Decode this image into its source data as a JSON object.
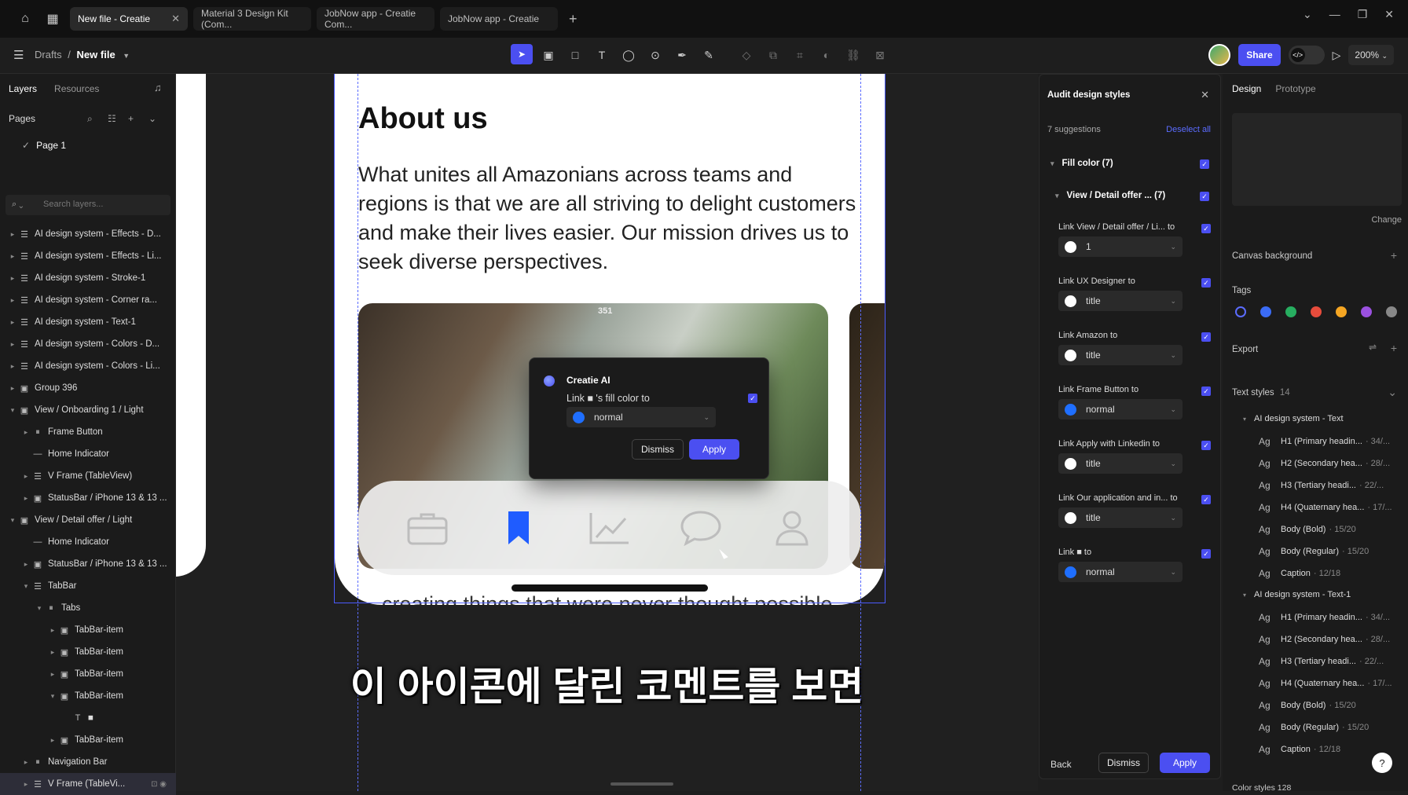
{
  "tabs": [
    {
      "label": "New file - Creatie",
      "active": true
    },
    {
      "label": "Material 3 Design Kit (Com...",
      "active": false
    },
    {
      "label": "JobNow app - Creatie Com...",
      "active": false
    },
    {
      "label": "JobNow app - Creatie",
      "active": false
    }
  ],
  "toolbar": {
    "crumb_parent": "Drafts",
    "crumb_sep": "/",
    "file_name": "New file",
    "share_label": "Share",
    "zoom": "200%"
  },
  "left": {
    "tab_layers": "Layers",
    "tab_resources": "Resources",
    "pages_label": "Pages",
    "page1": "Page 1",
    "search_placeholder": "Search layers...",
    "layers": [
      {
        "indent": 0,
        "arrow": "▸",
        "glyph": "☰",
        "label": "AI design system - Effects - D..."
      },
      {
        "indent": 0,
        "arrow": "▸",
        "glyph": "☰",
        "label": "AI design system - Effects - Li..."
      },
      {
        "indent": 0,
        "arrow": "▸",
        "glyph": "☰",
        "label": "AI design system - Stroke-1"
      },
      {
        "indent": 0,
        "arrow": "▸",
        "glyph": "☰",
        "label": "AI design system - Corner ra..."
      },
      {
        "indent": 0,
        "arrow": "▸",
        "glyph": "☰",
        "label": "AI design system - Text-1"
      },
      {
        "indent": 0,
        "arrow": "▸",
        "glyph": "☰",
        "label": "AI design system - Colors - D..."
      },
      {
        "indent": 0,
        "arrow": "▸",
        "glyph": "☰",
        "label": "AI design system - Colors - Li..."
      },
      {
        "indent": 0,
        "arrow": "▸",
        "glyph": "▣",
        "label": "Group 396"
      },
      {
        "indent": 0,
        "arrow": "▾",
        "glyph": "▣",
        "label": "View / Onboarding 1 / Light"
      },
      {
        "indent": 1,
        "arrow": "▸",
        "glyph": "⏸",
        "label": "Frame Button"
      },
      {
        "indent": 1,
        "arrow": "",
        "glyph": "—",
        "label": "Home Indicator"
      },
      {
        "indent": 1,
        "arrow": "▸",
        "glyph": "☰",
        "label": "V Frame (TableView)"
      },
      {
        "indent": 1,
        "arrow": "▸",
        "glyph": "▣",
        "label": "StatusBar / iPhone 13 & 13 ..."
      },
      {
        "indent": 0,
        "arrow": "▾",
        "glyph": "▣",
        "label": "View / Detail offer / Light"
      },
      {
        "indent": 1,
        "arrow": "",
        "glyph": "—",
        "label": "Home Indicator"
      },
      {
        "indent": 1,
        "arrow": "▸",
        "glyph": "▣",
        "label": "StatusBar / iPhone 13 & 13 ..."
      },
      {
        "indent": 1,
        "arrow": "▾",
        "glyph": "☰",
        "label": "TabBar"
      },
      {
        "indent": 2,
        "arrow": "▾",
        "glyph": "⏸",
        "label": "Tabs"
      },
      {
        "indent": 3,
        "arrow": "▸",
        "glyph": "▣",
        "label": "TabBar-item"
      },
      {
        "indent": 3,
        "arrow": "▸",
        "glyph": "▣",
        "label": "TabBar-item"
      },
      {
        "indent": 3,
        "arrow": "▸",
        "glyph": "▣",
        "label": "TabBar-item"
      },
      {
        "indent": 3,
        "arrow": "▾",
        "glyph": "▣",
        "label": "TabBar-item"
      },
      {
        "indent": 4,
        "arrow": "",
        "glyph": "T",
        "label": "■"
      },
      {
        "indent": 3,
        "arrow": "▸",
        "glyph": "▣",
        "label": "TabBar-item"
      },
      {
        "indent": 1,
        "arrow": "▸",
        "glyph": "⏸",
        "label": "Navigation Bar"
      },
      {
        "indent": 1,
        "arrow": "▸",
        "glyph": "☰",
        "label": "V Frame (TableVi...",
        "highlight": true
      }
    ]
  },
  "canvas": {
    "heading": "About us",
    "paragraph": "What unites all Amazonians across teams and regions is that we are all striving to delight customers and make their lives easier. Our mission drives us to seek diverse perspectives.",
    "photo_number": "351",
    "clipped_text": "creating things that were never thought possible",
    "subtitle": "이 아이콘에 달린 코멘트를 보면"
  },
  "ai_popup": {
    "title": "Creatie AI",
    "link_text": "Link ■ 's fill color to",
    "value": "normal",
    "dismiss": "Dismiss",
    "apply": "Apply"
  },
  "audit": {
    "title": "Audit design styles",
    "suggestions": "7 suggestions",
    "deselect_all": "Deselect all",
    "group1": "Fill color  (7)",
    "group2": "View / Detail offer ...  (7)",
    "rows": [
      {
        "label": "Link View / Detail offer / Li...  to",
        "value": "1",
        "color": "#ffffff"
      },
      {
        "label": "Link UX Designer  to",
        "value": "title",
        "color": "#ffffff"
      },
      {
        "label": "Link Amazon  to",
        "value": "title",
        "color": "#ffffff"
      },
      {
        "label": "Link Frame Button  to",
        "value": "normal",
        "color": "#1f6fff"
      },
      {
        "label": "Link Apply with Linkedin  to",
        "value": "title",
        "color": "#ffffff"
      },
      {
        "label": "Link Our application and in...  to",
        "value": "title",
        "color": "#ffffff"
      },
      {
        "label": "Link ■  to",
        "value": "normal",
        "color": "#1f6fff"
      }
    ],
    "back": "Back",
    "dismiss": "Dismiss",
    "apply": "Apply"
  },
  "design": {
    "tab_design": "Design",
    "tab_prototype": "Prototype",
    "change": "Change",
    "canvas_background": "Canvas background",
    "tags": "Tags",
    "tag_colors": [
      "#5b6cff",
      "#3b6cf6",
      "#27ae60",
      "#e74c3c",
      "#f5a623",
      "#9b51e0",
      "#888888"
    ],
    "export": "Export",
    "text_styles": "Text styles",
    "text_styles_count": "14",
    "style_groups": [
      {
        "name": "AI design system - Text",
        "items": [
          {
            "label": "H1 (Primary headin...",
            "size": "· 34/..."
          },
          {
            "label": "H2 (Secondary hea...",
            "size": "· 28/..."
          },
          {
            "label": "H3 (Tertiary headi...",
            "size": "· 22/..."
          },
          {
            "label": "H4 (Quaternary hea...",
            "size": "· 17/..."
          },
          {
            "label": "Body (Bold)",
            "size": "· 15/20"
          },
          {
            "label": "Body (Regular)",
            "size": "· 15/20"
          },
          {
            "label": "Caption",
            "size": "· 12/18"
          }
        ]
      },
      {
        "name": "AI design system - Text-1",
        "items": [
          {
            "label": "H1 (Primary headin...",
            "size": "· 34/..."
          },
          {
            "label": "H2 (Secondary hea...",
            "size": "· 28/..."
          },
          {
            "label": "H3 (Tertiary headi...",
            "size": "· 22/..."
          },
          {
            "label": "H4 (Quaternary hea...",
            "size": "· 17/..."
          },
          {
            "label": "Body (Bold)",
            "size": "· 15/20"
          },
          {
            "label": "Body (Regular)",
            "size": "· 15/20"
          },
          {
            "label": "Caption",
            "size": "· 12/18"
          }
        ]
      }
    ],
    "color_styles": "Color styles  128",
    "help": "?"
  }
}
